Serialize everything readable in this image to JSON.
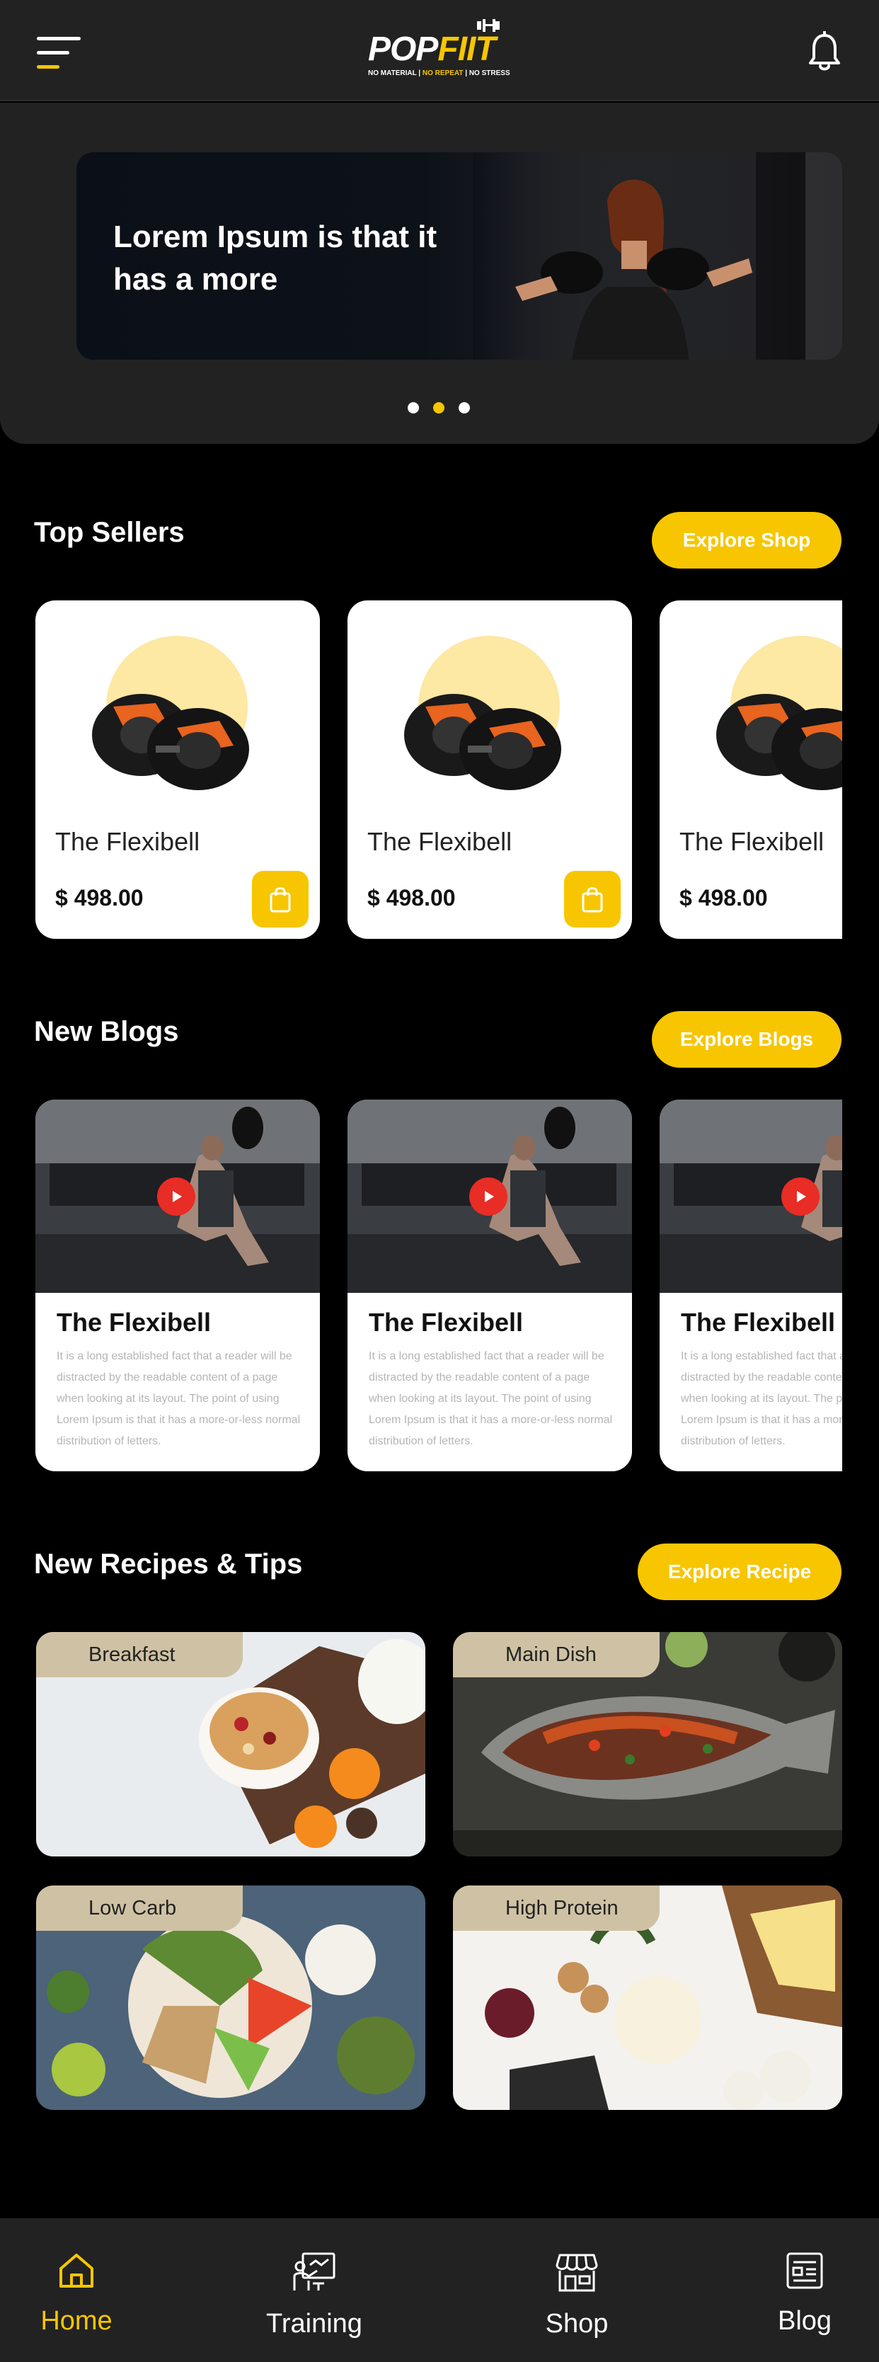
{
  "header": {
    "logo_part1": "POP",
    "logo_part2": "FIIT",
    "logo_tag_1": "NO MATERIAL | ",
    "logo_tag_2": "NO REPEAT",
    "logo_tag_3": " | NO STRESS"
  },
  "banner": {
    "title": "Lorem Ipsum is that it has a more",
    "slide_count": 3,
    "active_slide": 2
  },
  "top_sellers": {
    "title": "Top Sellers",
    "button": "Explore Shop",
    "products": [
      {
        "name": "The Flexibell",
        "price": "$ 498.00"
      },
      {
        "name": "The Flexibell",
        "price": "$ 498.00"
      },
      {
        "name": "The Flexibell",
        "price": "$ 498.00"
      }
    ]
  },
  "blogs": {
    "title": "New Blogs",
    "button": "Explore Blogs",
    "items": [
      {
        "title": "The Flexibell",
        "body": "It is a long established fact that a reader will be distracted by the readable content of a page when looking at its layout. The point of using Lorem Ipsum is that it has a more-or-less normal distribution of letters."
      },
      {
        "title": "The Flexibell",
        "body": "It is a long established fact that a reader will be distracted by the readable content of a page when looking at its layout. The point of using Lorem Ipsum is that it has a more-or-less normal distribution of letters."
      },
      {
        "title": "The Flexibell",
        "body": "It is a long established fact that a reader will be distracted by the readable content of a page when looking at its layout. The point of using Lorem Ipsum is that it has a more-or-less normal distribution of letters."
      }
    ]
  },
  "recipes": {
    "title": "New Recipes & Tips",
    "button": "Explore Recipe",
    "items": [
      {
        "label": "Breakfast"
      },
      {
        "label": "Main Dish"
      },
      {
        "label": "Low Carb"
      },
      {
        "label": "High Protein"
      }
    ]
  },
  "nav": {
    "items": [
      {
        "label": "Home",
        "icon": "home-icon",
        "active": true
      },
      {
        "label": "Training",
        "icon": "training-icon",
        "active": false
      },
      {
        "label": "Shop",
        "icon": "shop-icon",
        "active": false
      },
      {
        "label": "Blog",
        "icon": "blog-icon",
        "active": false
      }
    ]
  },
  "colors": {
    "accent": "#f7c600",
    "surface": "#222222",
    "background": "#000000",
    "play": "#e82c26"
  }
}
